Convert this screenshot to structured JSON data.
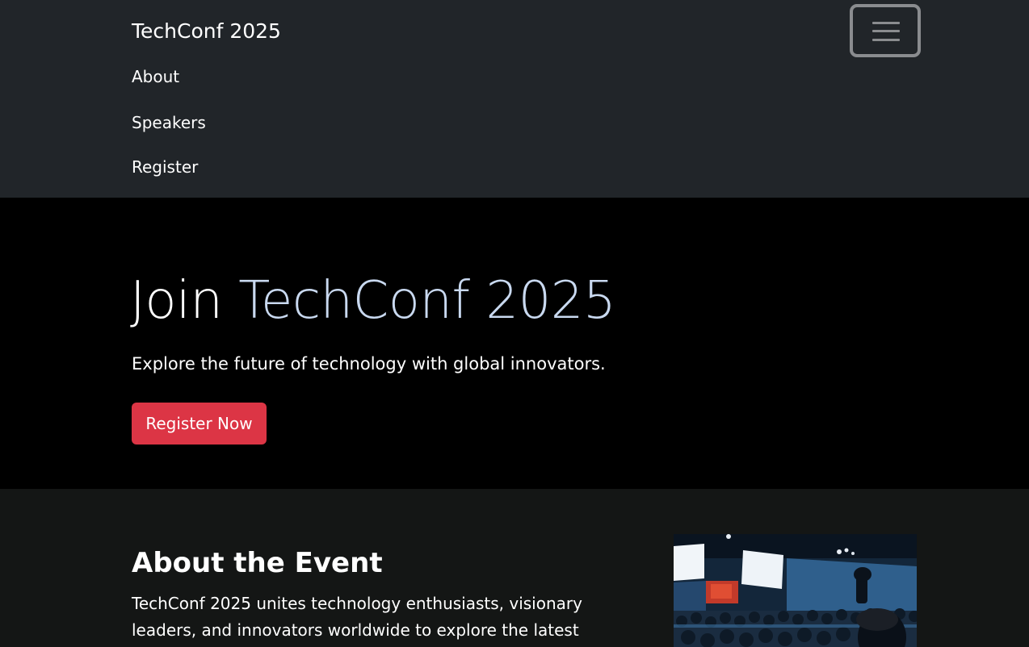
{
  "navbar": {
    "brand": "TechConf 2025",
    "links": [
      {
        "label": "About"
      },
      {
        "label": "Speakers"
      },
      {
        "label": "Register"
      }
    ],
    "toggler_icon": "hamburger-menu-icon"
  },
  "hero": {
    "title_lead": "Join",
    "title_accent": "TechConf 2025",
    "subtitle": "Explore the future of technology with global innovators.",
    "cta_label": "Register Now"
  },
  "about": {
    "title": "About the Event",
    "text": "TechConf 2025 unites technology enthusiasts, visionary leaders, and innovators worldwide to explore the latest advancements in",
    "image_subject": "conference-audience-photo"
  },
  "colors": {
    "navbar_bg": "#212529",
    "hero_bg": "#000000",
    "about_bg": "#141615",
    "accent_text": "#c9d9f0",
    "cta_bg": "#dc3545",
    "toggler_border": "#8a8c8f"
  }
}
